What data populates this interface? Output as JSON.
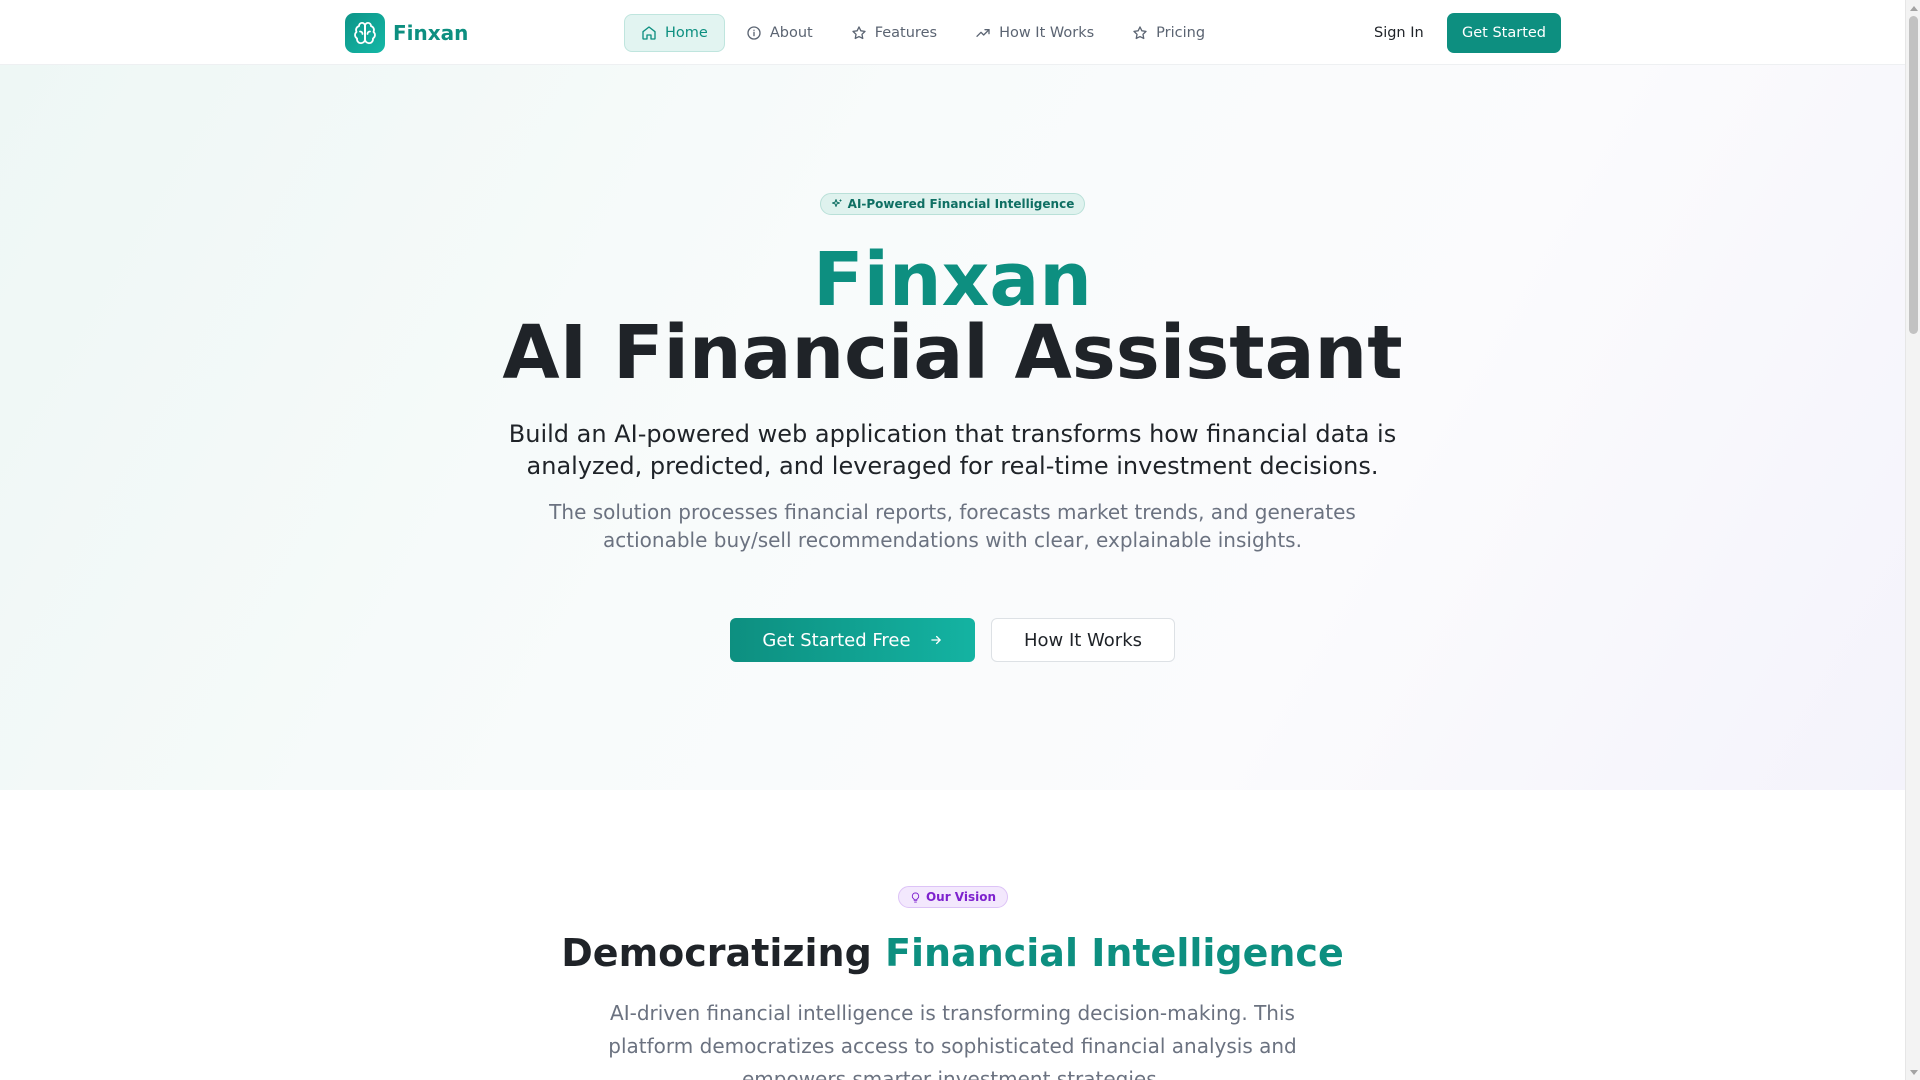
{
  "brand": {
    "name": "Finxan",
    "logo_icon": "brain-icon",
    "accent_color": "#0d8f80"
  },
  "nav": {
    "items": [
      {
        "label": "Home",
        "icon": "home-icon",
        "active": true
      },
      {
        "label": "About",
        "icon": "info-icon",
        "active": false
      },
      {
        "label": "Features",
        "icon": "star-icon",
        "active": false
      },
      {
        "label": "How It Works",
        "icon": "trending-up-icon",
        "active": false
      },
      {
        "label": "Pricing",
        "icon": "star-icon",
        "active": false
      }
    ]
  },
  "header": {
    "sign_in": "Sign In",
    "get_started": "Get Started"
  },
  "hero": {
    "badge": "AI-Powered Financial Intelligence",
    "badge_icon": "sparkles-icon",
    "title_accent": "Finxan",
    "title": "AI Financial Assistant",
    "subtitle": "Build an AI-powered web application that transforms how financial data is analyzed, predicted, and leveraged for real-time investment decisions.",
    "description": "The solution processes financial reports, forecasts market trends, and generates actionable buy/sell recommendations with clear, explainable insights.",
    "primary_button": "Get Started Free",
    "primary_button_icon": "arrow-right-icon",
    "secondary_button": "How It Works"
  },
  "vision": {
    "badge": "Our Vision",
    "badge_icon": "lightbulb-icon",
    "title_prefix": "Democratizing",
    "title_accent": "Financial Intelligence",
    "text": "AI-driven financial intelligence is transforming decision-making. This platform democratizes access to sophisticated financial analysis and empowers smarter investment strategies."
  }
}
